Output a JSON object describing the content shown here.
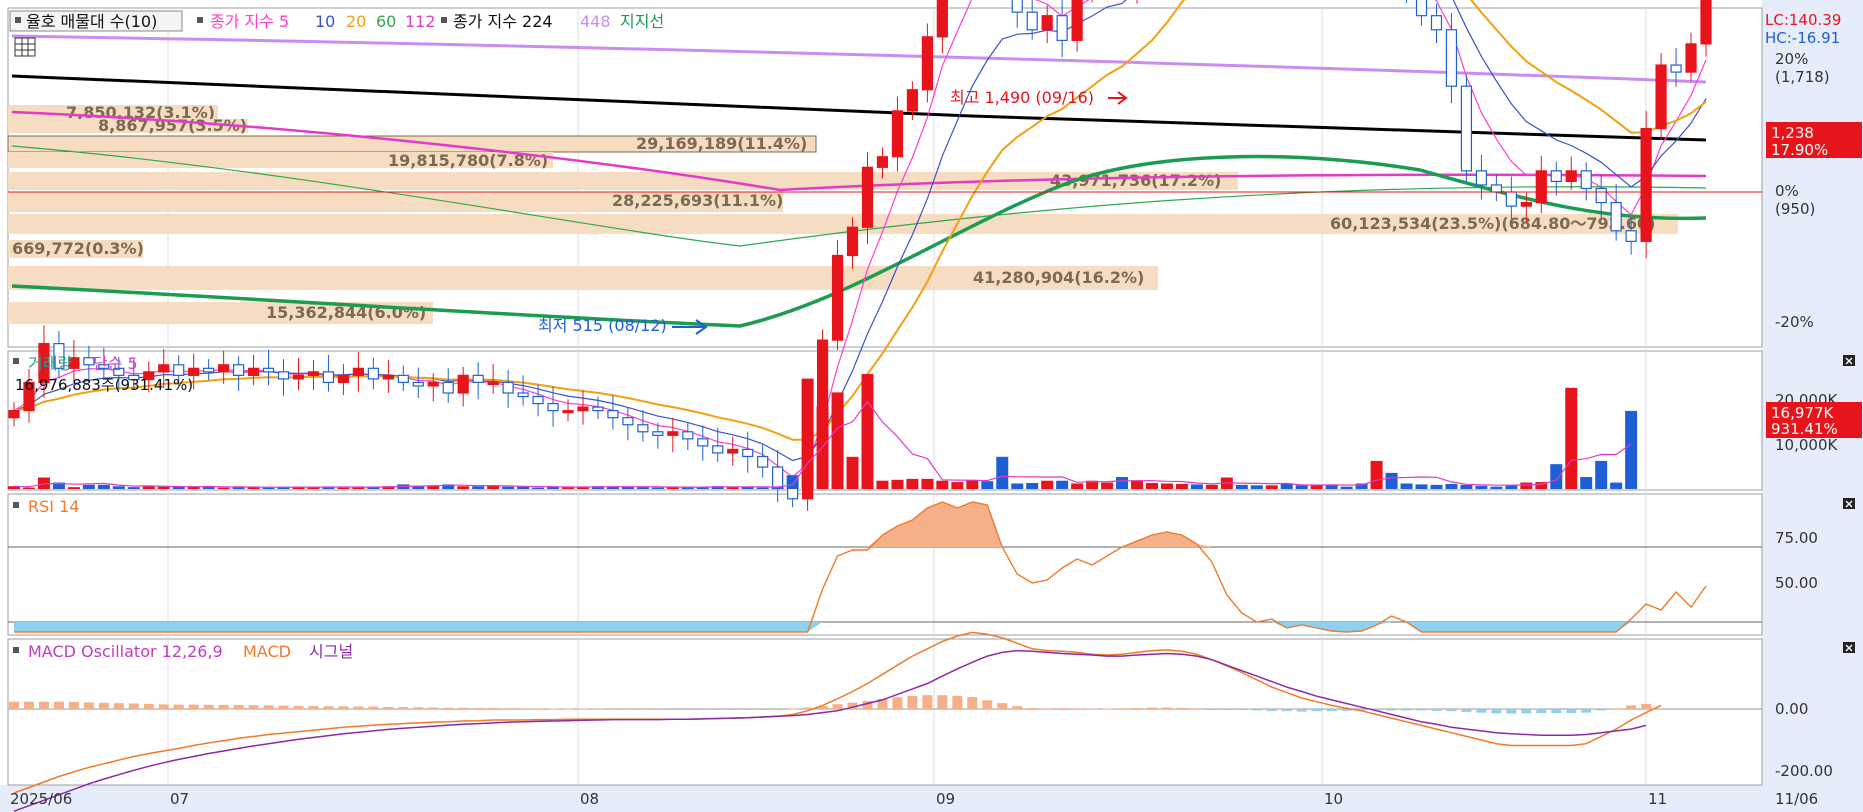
{
  "colors": {
    "up": "#e8141c",
    "down": "#1f5fd6",
    "ma5": "#ff3cd2",
    "ma10": "#3a52c8",
    "ma20": "#f2a012",
    "ma60": "#2fa84f",
    "ma112": "#e23ac9",
    "ma224": "#000000",
    "ma448": "#c88cf2",
    "support": "#1b9c50",
    "vol_avg": "#e23ac9",
    "rsi": "#f07a2a",
    "macd": "#f07a2a",
    "signal": "#8a2aa8",
    "osc_pos": "#f5b08a",
    "osc_neg": "#8ed0f0",
    "band": "#f6dcc0",
    "axis_bg": "#e6ecfa"
  },
  "legend_price": {
    "item1": "율호 매물대 수(10)",
    "item2_prefix": "종가 지수 5",
    "item2_n10": "10",
    "item2_n20": "20",
    "item2_n60": "60",
    "item2_n112": "112",
    "item3_prefix": "종가 지수 224",
    "item3_n448": "448",
    "item3_support": "지지선"
  },
  "right_top": {
    "lc": "LC:140.39",
    "hc": "HC:-16.91"
  },
  "price_axis": {
    "p20": "20%",
    "p20_val": "(1,718)",
    "p0": "0%",
    "p0_val": "(950)",
    "m20": "-20%",
    "last_price": "1,238",
    "last_pct": "17.90%"
  },
  "annotations": {
    "high": "최고 1,490 (09/16)",
    "low": "최저 515 (08/12)"
  },
  "volume_profile": [
    {
      "label": "7,850,132(3.1%)"
    },
    {
      "label": "8,867,957(3.5%)"
    },
    {
      "label": "29,169,189(11.4%)"
    },
    {
      "label": "19,815,780(7.8%)"
    },
    {
      "label": "28,225,693(11.1%)"
    },
    {
      "label": "43,971,736(17.2%)"
    },
    {
      "label": "60,123,534(23.5%)(684.80～793.60)"
    },
    {
      "label": "669,772(0.3%)"
    },
    {
      "label": "41,280,904(16.2%)"
    },
    {
      "label": "15,362,844(6.0%)"
    }
  ],
  "volume_panel": {
    "title": "거래량",
    "ma_label": "단순 5",
    "current": "16,976,883주(931.41%)",
    "axis_20k": "20,000K",
    "axis_10k": "10,000K",
    "last_val": "16,977K",
    "last_pct": "931.41%"
  },
  "rsi_panel": {
    "title": "RSI 14",
    "axis_75": "75.00",
    "axis_50": "50.00"
  },
  "macd_panel": {
    "title": "MACD Oscillator 12,26,9",
    "macd_label": "MACD",
    "signal_label": "시그널",
    "axis_0": "0.00",
    "axis_m200": "-200.00"
  },
  "x_axis": {
    "labels": [
      "2025/06",
      "07",
      "08",
      "09",
      "10",
      "11"
    ],
    "right_label": "11/06"
  },
  "chart_data": {
    "type": "candlestick",
    "price": {
      "high_close": 1490,
      "low_close": 515,
      "last": 1238
    },
    "closes": [
      640,
      680,
      735,
      700,
      715,
      705,
      700,
      690,
      684,
      695,
      705,
      690,
      700,
      695,
      705,
      690,
      700,
      695,
      685,
      690,
      695,
      680,
      690,
      700,
      685,
      690,
      680,
      675,
      680,
      665,
      690,
      680,
      680,
      665,
      660,
      650,
      640,
      640,
      645,
      640,
      630,
      620,
      610,
      605,
      610,
      600,
      590,
      580,
      585,
      575,
      560,
      530,
      515,
      600,
      740,
      860,
      900,
      985,
      1000,
      1065,
      1095,
      1170,
      1275,
      1275,
      1320,
      1305,
      1300,
      1205,
      1180,
      1200,
      1165,
      1240,
      1250,
      1270,
      1240,
      1320,
      1345,
      1430,
      1490,
      1460,
      1470,
      1475,
      1440,
      1390,
      1400,
      1320,
      1310,
      1320,
      1300,
      1280,
      1260,
      1260,
      1250,
      1240,
      1200,
      1180,
      1100,
      980,
      960,
      950,
      930,
      935,
      980,
      965,
      980,
      955,
      935,
      895,
      880,
      1040,
      1130,
      1120,
      1160,
      1238
    ],
    "volume_K": [
      600,
      300,
      2500,
      1400,
      400,
      900,
      900,
      600,
      400,
      600,
      500,
      500,
      500,
      600,
      300,
      400,
      400,
      300,
      500,
      500,
      400,
      500,
      300,
      500,
      400,
      600,
      1000,
      700,
      800,
      1000,
      600,
      600,
      700,
      500,
      500,
      300,
      500,
      400,
      500,
      600,
      500,
      500,
      400,
      300,
      500,
      400,
      500,
      600,
      400,
      500,
      300,
      400,
      3000,
      24000,
      18000,
      21000,
      7000,
      25000,
      1800,
      2000,
      2200,
      2200,
      1800,
      1500,
      1900,
      1700,
      7000,
      1200,
      1300,
      1800,
      1800,
      1200,
      1800,
      1400,
      2600,
      1900,
      1300,
      1200,
      1100,
      1000,
      900,
      2500,
      900,
      800,
      800,
      1100,
      800,
      900,
      900,
      500,
      1200,
      6100,
      3500,
      1200,
      1000,
      900,
      1100,
      900,
      700,
      500,
      900,
      1400,
      1500,
      5400,
      22000,
      2600,
      6100,
      1400,
      16977
    ],
    "rsi": [
      17,
      20,
      29,
      31,
      33,
      32,
      31,
      30,
      29,
      31,
      33,
      31,
      33,
      32,
      34,
      32,
      34,
      33,
      32,
      33,
      34,
      32,
      33,
      36,
      32,
      35,
      33,
      32,
      33,
      31,
      38,
      35,
      34,
      31,
      31,
      30,
      30,
      31,
      33,
      31,
      30,
      29,
      28,
      28,
      31,
      30,
      28,
      30,
      29,
      29,
      28,
      24,
      27,
      44,
      61,
      72,
      74,
      74,
      79,
      82,
      84,
      88,
      90,
      88,
      90,
      89,
      75,
      66,
      63,
      64,
      68,
      71,
      69,
      72,
      75,
      77,
      79,
      80,
      79,
      76,
      70,
      59,
      53,
      50,
      51,
      48,
      49,
      48,
      47,
      46,
      47,
      49,
      52,
      50,
      45,
      33,
      36,
      35,
      35,
      34,
      35,
      34,
      36,
      37,
      36,
      34,
      34,
      33,
      51,
      56,
      54,
      60,
      55,
      62
    ],
    "rsi_scale": {
      "ref_hi": 75,
      "ref_lo": 50
    },
    "macd": [
      -230,
      -215,
      -200,
      -185,
      -172,
      -160,
      -150,
      -140,
      -130,
      -122,
      -115,
      -108,
      -100,
      -93,
      -87,
      -80,
      -75,
      -70,
      -66,
      -62,
      -58,
      -54,
      -50,
      -47,
      -44,
      -42,
      -40,
      -38,
      -36,
      -35,
      -33,
      -32,
      -30,
      -30,
      -30,
      -29,
      -29,
      -28,
      -28,
      -28,
      -28,
      -28,
      -28,
      -28,
      -28,
      -28,
      -27,
      -26,
      -25,
      -24,
      -22,
      -20,
      -15,
      -5,
      10,
      28,
      48,
      70,
      95,
      120,
      145,
      165,
      185,
      200,
      210,
      205,
      195,
      180,
      165,
      160,
      158,
      155,
      150,
      148,
      150,
      155,
      160,
      162,
      158,
      150,
      135,
      118,
      100,
      80,
      60,
      45,
      30,
      20,
      10,
      2,
      -5,
      -15,
      -25,
      -35,
      -45,
      -55,
      -65,
      -75,
      -85,
      -95,
      -100,
      -100,
      -100,
      -100,
      -100,
      -95,
      -75,
      -55,
      -30,
      -10,
      10
    ],
    "signal": [
      -280,
      -265,
      -250,
      -235,
      -220,
      -205,
      -192,
      -180,
      -168,
      -157,
      -147,
      -138,
      -130,
      -122,
      -115,
      -108,
      -101,
      -95,
      -89,
      -83,
      -78,
      -73,
      -68,
      -64,
      -60,
      -56,
      -53,
      -50,
      -47,
      -44,
      -42,
      -40,
      -38,
      -36,
      -35,
      -34,
      -33,
      -32,
      -31,
      -30,
      -29,
      -29,
      -29,
      -29,
      -28,
      -28,
      -27,
      -26,
      -25,
      -24,
      -22,
      -20,
      -18,
      -15,
      -10,
      -5,
      5,
      15,
      25,
      40,
      55,
      70,
      90,
      110,
      128,
      145,
      155,
      160,
      158,
      155,
      152,
      150,
      148,
      145,
      145,
      148,
      150,
      152,
      150,
      145,
      135,
      120,
      105,
      90,
      75,
      60,
      48,
      35,
      25,
      15,
      5,
      -5,
      -15,
      -25,
      -35,
      -42,
      -50,
      -55,
      -60,
      -65,
      -68,
      -70,
      -72,
      -72,
      -72,
      -70,
      -65,
      -60,
      -55,
      -45
    ],
    "osc_scale": 250
  }
}
